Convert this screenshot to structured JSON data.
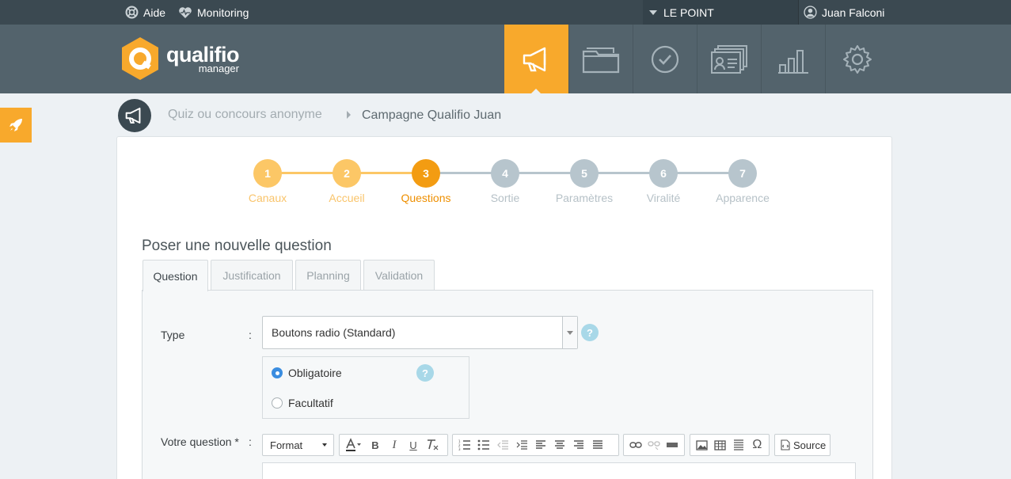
{
  "topbar": {
    "help_label": "Aide",
    "monitoring_label": "Monitoring",
    "account_label": "LE POINT",
    "user_name": "Juan Falconi"
  },
  "header": {
    "logo_main": "qualifio",
    "logo_sub": "manager",
    "nav": [
      {
        "icon": "megaphone-icon",
        "active": true
      },
      {
        "icon": "folder-icon",
        "active": false
      },
      {
        "icon": "check-circle-icon",
        "active": false
      },
      {
        "icon": "contacts-icon",
        "active": false
      },
      {
        "icon": "bar-chart-icon",
        "active": false
      },
      {
        "icon": "gear-icon",
        "active": false
      }
    ]
  },
  "breadcrumb": {
    "parent": "Quiz ou concours anonyme",
    "current": "Campagne Qualifio Juan"
  },
  "steps": [
    {
      "num": "1",
      "label": "Canaux",
      "state": "done"
    },
    {
      "num": "2",
      "label": "Accueil",
      "state": "done"
    },
    {
      "num": "3",
      "label": "Questions",
      "state": "current"
    },
    {
      "num": "4",
      "label": "Sortie",
      "state": "todo"
    },
    {
      "num": "5",
      "label": "Paramètres",
      "state": "todo"
    },
    {
      "num": "6",
      "label": "Viralité",
      "state": "todo"
    },
    {
      "num": "7",
      "label": "Apparence",
      "state": "todo"
    }
  ],
  "form": {
    "section_title": "Poser une nouvelle question",
    "tabs": [
      "Question",
      "Justification",
      "Planning",
      "Validation"
    ],
    "type_label": "Type",
    "colon": ":",
    "type_value": "Boutons radio (Standard)",
    "help_glyph": "?",
    "radio_required": "Obligatoire",
    "radio_optional": "Facultatif",
    "question_label": "Votre question *",
    "format_label": "Format",
    "source_label": "Source"
  },
  "colors": {
    "accent": "#f8a92c",
    "topbar": "#3b4951",
    "header": "#53636c",
    "step_done": "#fcc766",
    "step_current": "#f39c12",
    "step_todo": "#b7c5cd"
  }
}
